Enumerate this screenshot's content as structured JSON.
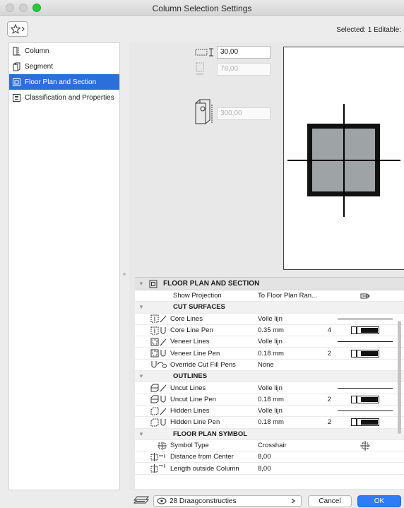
{
  "window": {
    "title": "Column Selection Settings"
  },
  "toolbar": {
    "selection_info": "Selected: 1 Editable:"
  },
  "sidebar": {
    "items": [
      {
        "label": "Column",
        "icon": "column-icon"
      },
      {
        "label": "Segment",
        "icon": "segment-icon"
      },
      {
        "label": "Floor Plan and Section",
        "icon": "floor-plan-icon",
        "selected": true
      },
      {
        "label": "Classification and Properties",
        "icon": "properties-icon"
      }
    ]
  },
  "geometry": {
    "width_value": "30,00",
    "depth_value": "78,00",
    "height_value": "300,00"
  },
  "panel": {
    "title": "FLOOR PLAN AND SECTION",
    "show_projection_label": "Show Projection",
    "show_projection_value": "To Floor Plan Ran...",
    "sections": {
      "cut_surfaces": "CUT SURFACES",
      "outlines": "OUTLINES",
      "floor_plan_symbol": "FLOOR PLAN SYMBOL"
    },
    "rows": {
      "core_lines": {
        "label": "Core Lines",
        "value": "Volle lijn"
      },
      "core_line_pen": {
        "label": "Core Line Pen",
        "value": "0.35 mm",
        "pen": "4"
      },
      "veneer_lines": {
        "label": "Veneer Lines",
        "value": "Volle lijn"
      },
      "veneer_line_pen": {
        "label": "Veneer Line Pen",
        "value": "0.18 mm",
        "pen": "2"
      },
      "override_cut_fill": {
        "label": "Override Cut Fill Pens",
        "value": "None"
      },
      "uncut_lines": {
        "label": "Uncut Lines",
        "value": "Volle lijn"
      },
      "uncut_line_pen": {
        "label": "Uncut Line Pen",
        "value": "0.18 mm",
        "pen": "2"
      },
      "hidden_lines": {
        "label": "Hidden Lines",
        "value": "Volle lijn"
      },
      "hidden_line_pen": {
        "label": "Hidden Line Pen",
        "value": "0.18 mm",
        "pen": "2"
      },
      "symbol_type": {
        "label": "Symbol Type",
        "value": "Crosshair"
      },
      "distance_center": {
        "label": "Distance from Center",
        "value": "8,00"
      },
      "length_outside": {
        "label": "Length outside Column",
        "value": "8,00"
      }
    }
  },
  "footer": {
    "layer": "28 Draagconstructies",
    "cancel": "Cancel",
    "ok": "OK"
  },
  "colors": {
    "accent": "#2c6fd9",
    "ok_button": "#2e7cf6",
    "column_fill": "#9ea3a6"
  }
}
